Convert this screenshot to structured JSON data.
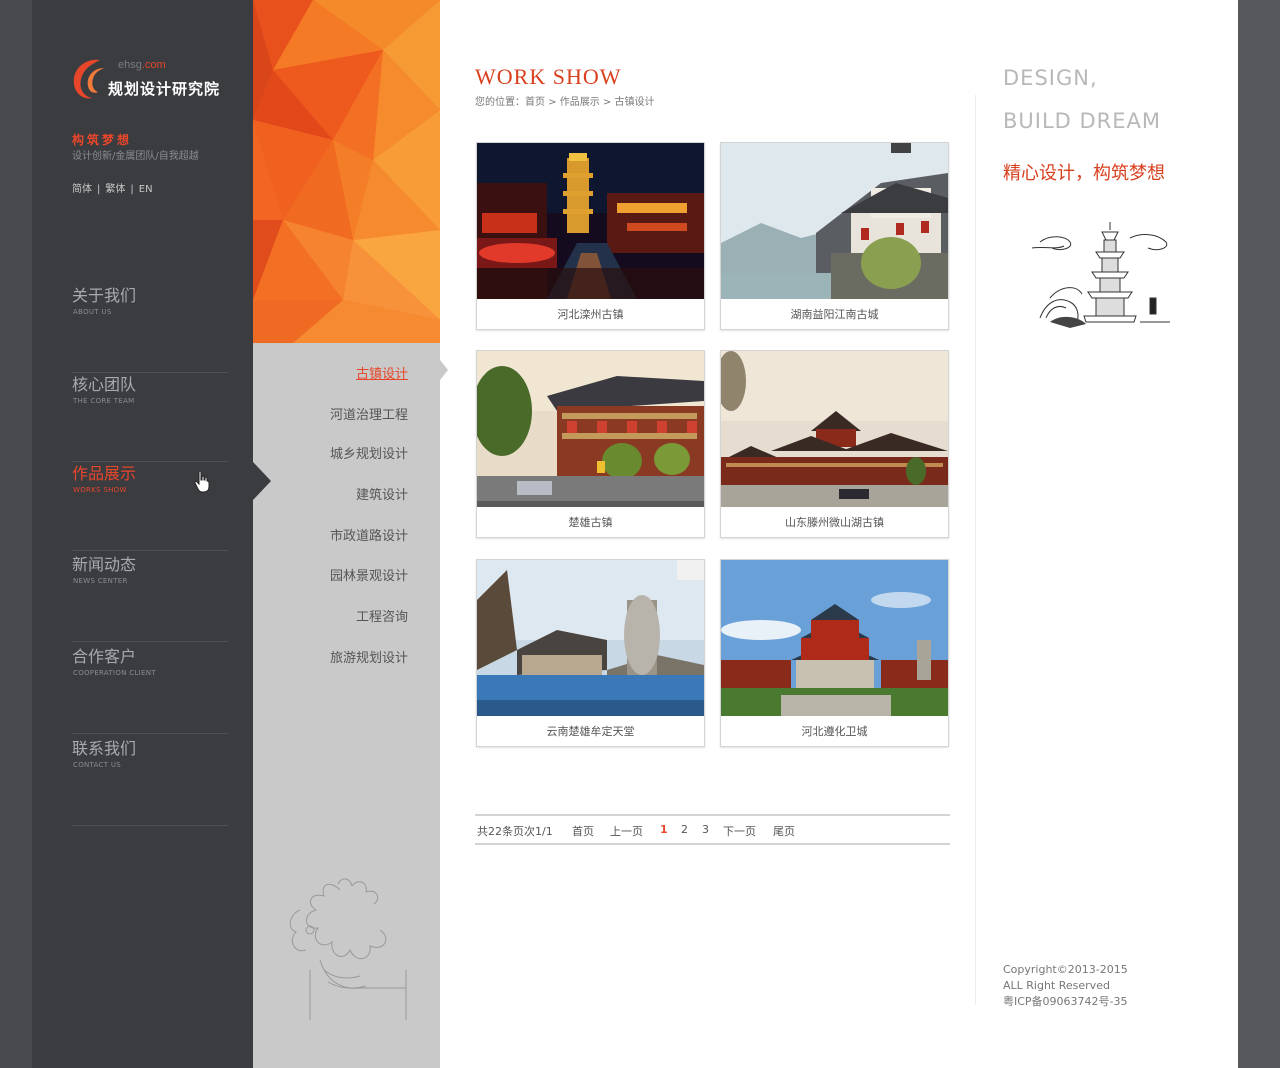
{
  "logo": {
    "domain_prefix": "ehsg",
    "domain_suffix": ".com",
    "name": "规划设计研究院"
  },
  "slogan": {
    "title": "构筑梦想",
    "subtitle": "设计创新/金属团队/自我超越"
  },
  "languages": [
    "简体",
    "繁体",
    "EN"
  ],
  "nav": {
    "items": [
      {
        "cn": "关于我们",
        "en": "ABOUT US"
      },
      {
        "cn": "核心团队",
        "en": "THE CORE TEAM"
      },
      {
        "cn": "作品展示",
        "en": "WORKS SHOW"
      },
      {
        "cn": "新闻动态",
        "en": "NEWS CENTER"
      },
      {
        "cn": "合作客户",
        "en": "COOPERATION CLIENT"
      },
      {
        "cn": "联系我们",
        "en": "CONTACT US"
      }
    ],
    "active_index": 2
  },
  "subnav": {
    "items": [
      "古镇设计",
      "河道治理工程",
      "城乡规划设计",
      "建筑设计",
      "市政道路设计",
      "园林景观设计",
      "工程咨询",
      "旅游规划设计"
    ],
    "active_index": 0
  },
  "main": {
    "title": "WORK SHOW",
    "breadcrumb": "您的位置：首页 > 作品展示 > 古镇设计",
    "works": [
      "河北滦州古镇",
      "湖南益阳江南古城",
      "楚雄古镇",
      "山东滕州微山湖古镇",
      "云南楚雄牟定天堂",
      "河北遵化卫城"
    ]
  },
  "pager": {
    "summary": "共22条页次1/1",
    "first": "首页",
    "prev": "上一页",
    "pages": [
      "1",
      "2",
      "3"
    ],
    "current": "1",
    "next": "下一页",
    "last": "尾页"
  },
  "aside": {
    "line1": "DESIGN,",
    "line2": "BUILD  DREAM",
    "motto": "精心设计，构筑梦想",
    "copyright": [
      "Copyright©2013-2015",
      "ALL Right Reserved",
      "粤ICP备09063742号-35"
    ]
  },
  "colors": {
    "accent": "#e8462a",
    "nav_bg": "#3a3c40",
    "subnav_bg": "#c9c9c9"
  }
}
